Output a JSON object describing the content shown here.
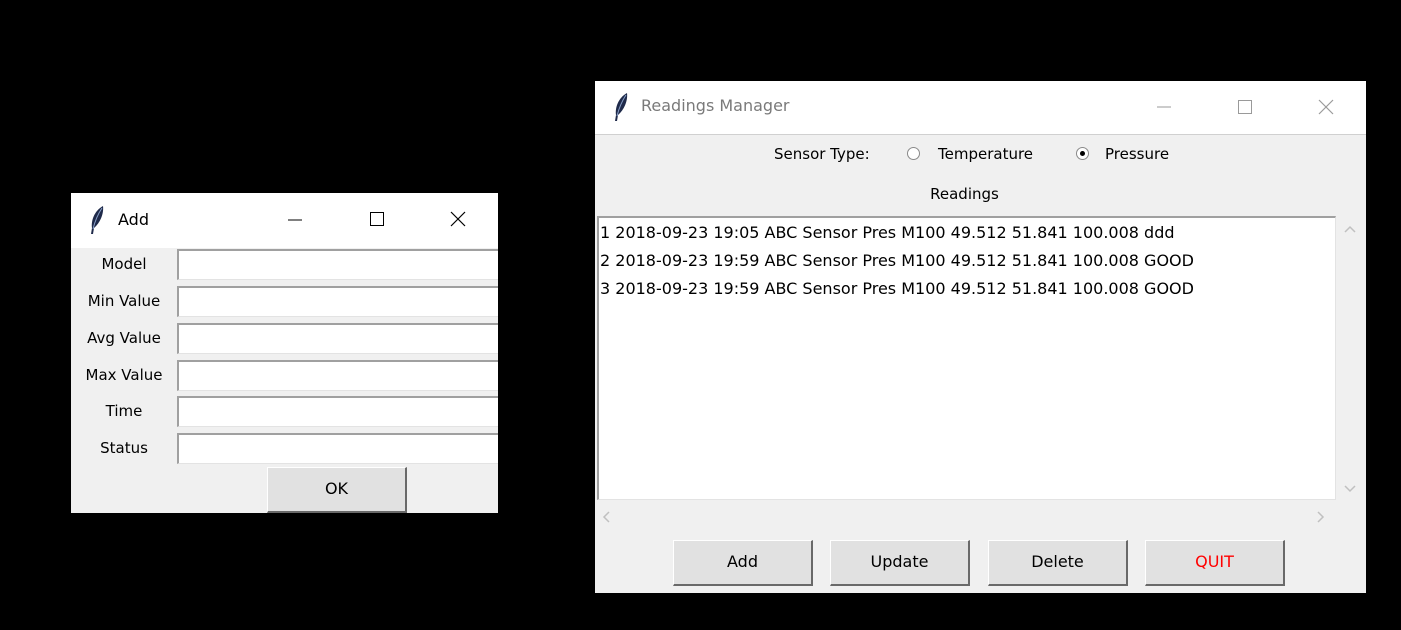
{
  "add_dialog": {
    "title": "Add",
    "fields": [
      {
        "label": "Model",
        "value": ""
      },
      {
        "label": "Min Value",
        "value": ""
      },
      {
        "label": "Avg Value",
        "value": ""
      },
      {
        "label": "Max Value",
        "value": ""
      },
      {
        "label": "Time",
        "value": ""
      },
      {
        "label": "Status",
        "value": ""
      }
    ],
    "ok_label": "OK"
  },
  "readings_manager": {
    "title": "Readings Manager",
    "sensor_type_label": "Sensor Type:",
    "options": [
      {
        "label": "Temperature",
        "selected": false
      },
      {
        "label": "Pressure",
        "selected": true
      }
    ],
    "readings_label": "Readings",
    "readings": [
      "1 2018-09-23 19:05 ABC Sensor Pres M100 49.512 51.841 100.008 ddd",
      "2 2018-09-23 19:59 ABC Sensor Pres M100 49.512 51.841 100.008 GOOD",
      "3 2018-09-23 19:59 ABC Sensor Pres M100 49.512 51.841 100.008 GOOD"
    ],
    "buttons": {
      "add": "Add",
      "update": "Update",
      "delete": "Delete",
      "quit": "QUIT"
    },
    "quit_color": "#ff0000"
  },
  "icons": {
    "app_icon": "feather-icon",
    "minimize": "minimize-icon",
    "maximize": "maximize-icon",
    "close": "close-icon"
  }
}
